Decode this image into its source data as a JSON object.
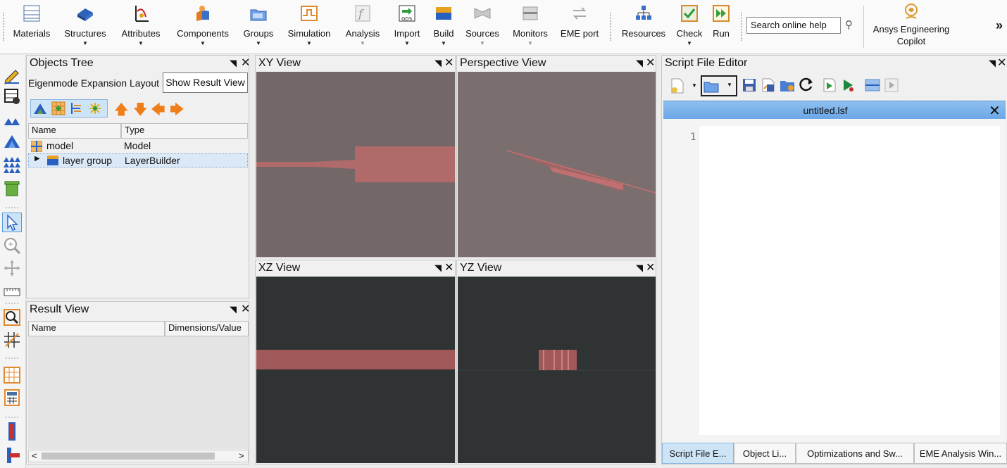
{
  "ribbon": {
    "items": [
      {
        "label": "Materials",
        "dropdown": false,
        "icon": "materials-icon"
      },
      {
        "label": "Structures",
        "dropdown": true,
        "icon": "structures-icon"
      },
      {
        "label": "Attributes",
        "dropdown": true,
        "icon": "attributes-icon"
      },
      {
        "label": "Components",
        "dropdown": true,
        "icon": "components-icon"
      },
      {
        "label": "Groups",
        "dropdown": true,
        "icon": "groups-icon"
      },
      {
        "label": "Simulation",
        "dropdown": true,
        "icon": "simulation-icon"
      },
      {
        "label": "Analysis",
        "dropdown": true,
        "icon": "analysis-icon"
      },
      {
        "label": "Import",
        "dropdown": true,
        "icon": "import-gds-icon"
      },
      {
        "label": "Build",
        "dropdown": true,
        "icon": "build-icon"
      },
      {
        "label": "Sources",
        "dropdown": true,
        "icon": "sources-icon"
      },
      {
        "label": "Monitors",
        "dropdown": true,
        "icon": "monitors-icon"
      },
      {
        "label": "EME port",
        "dropdown": false,
        "icon": "eme-port-icon"
      },
      {
        "label": "Resources",
        "dropdown": false,
        "icon": "resources-icon"
      },
      {
        "label": "Check",
        "dropdown": true,
        "icon": "check-icon"
      },
      {
        "label": "Run",
        "dropdown": false,
        "icon": "run-icon"
      }
    ],
    "import_icon_text": "GDS",
    "search_placeholder": "Search online help",
    "copilot_line1": "Ansys Engineering",
    "copilot_line2": "Copilot",
    "overflow": "»"
  },
  "objects_tree": {
    "title": "Objects Tree",
    "layout_label": "Eigenmode Expansion Layout",
    "show_result_button": "Show Result View",
    "col_name": "Name",
    "col_type": "Type",
    "rows": [
      {
        "name": "model",
        "type": "Model"
      },
      {
        "name": "layer group",
        "type": "LayerBuilder"
      }
    ]
  },
  "result_view": {
    "title": "Result View",
    "col_name": "Name",
    "col_dims": "Dimensions/Value"
  },
  "views": {
    "xy": "XY View",
    "perspective": "Perspective View",
    "xz": "XZ View",
    "yz": "YZ View"
  },
  "script_editor": {
    "title": "Script File Editor",
    "filename": "untitled.lsf",
    "line_number": "1"
  },
  "bottom_tabs": [
    "Script File E...",
    "Object Li...",
    "Optimizations and Sw...",
    "EME Analysis Win..."
  ],
  "colors": {
    "view_bg_light": "#736767",
    "view_bg_dark": "#2f3334",
    "structure": "#b06a6a",
    "accent": "#cde4f7"
  }
}
